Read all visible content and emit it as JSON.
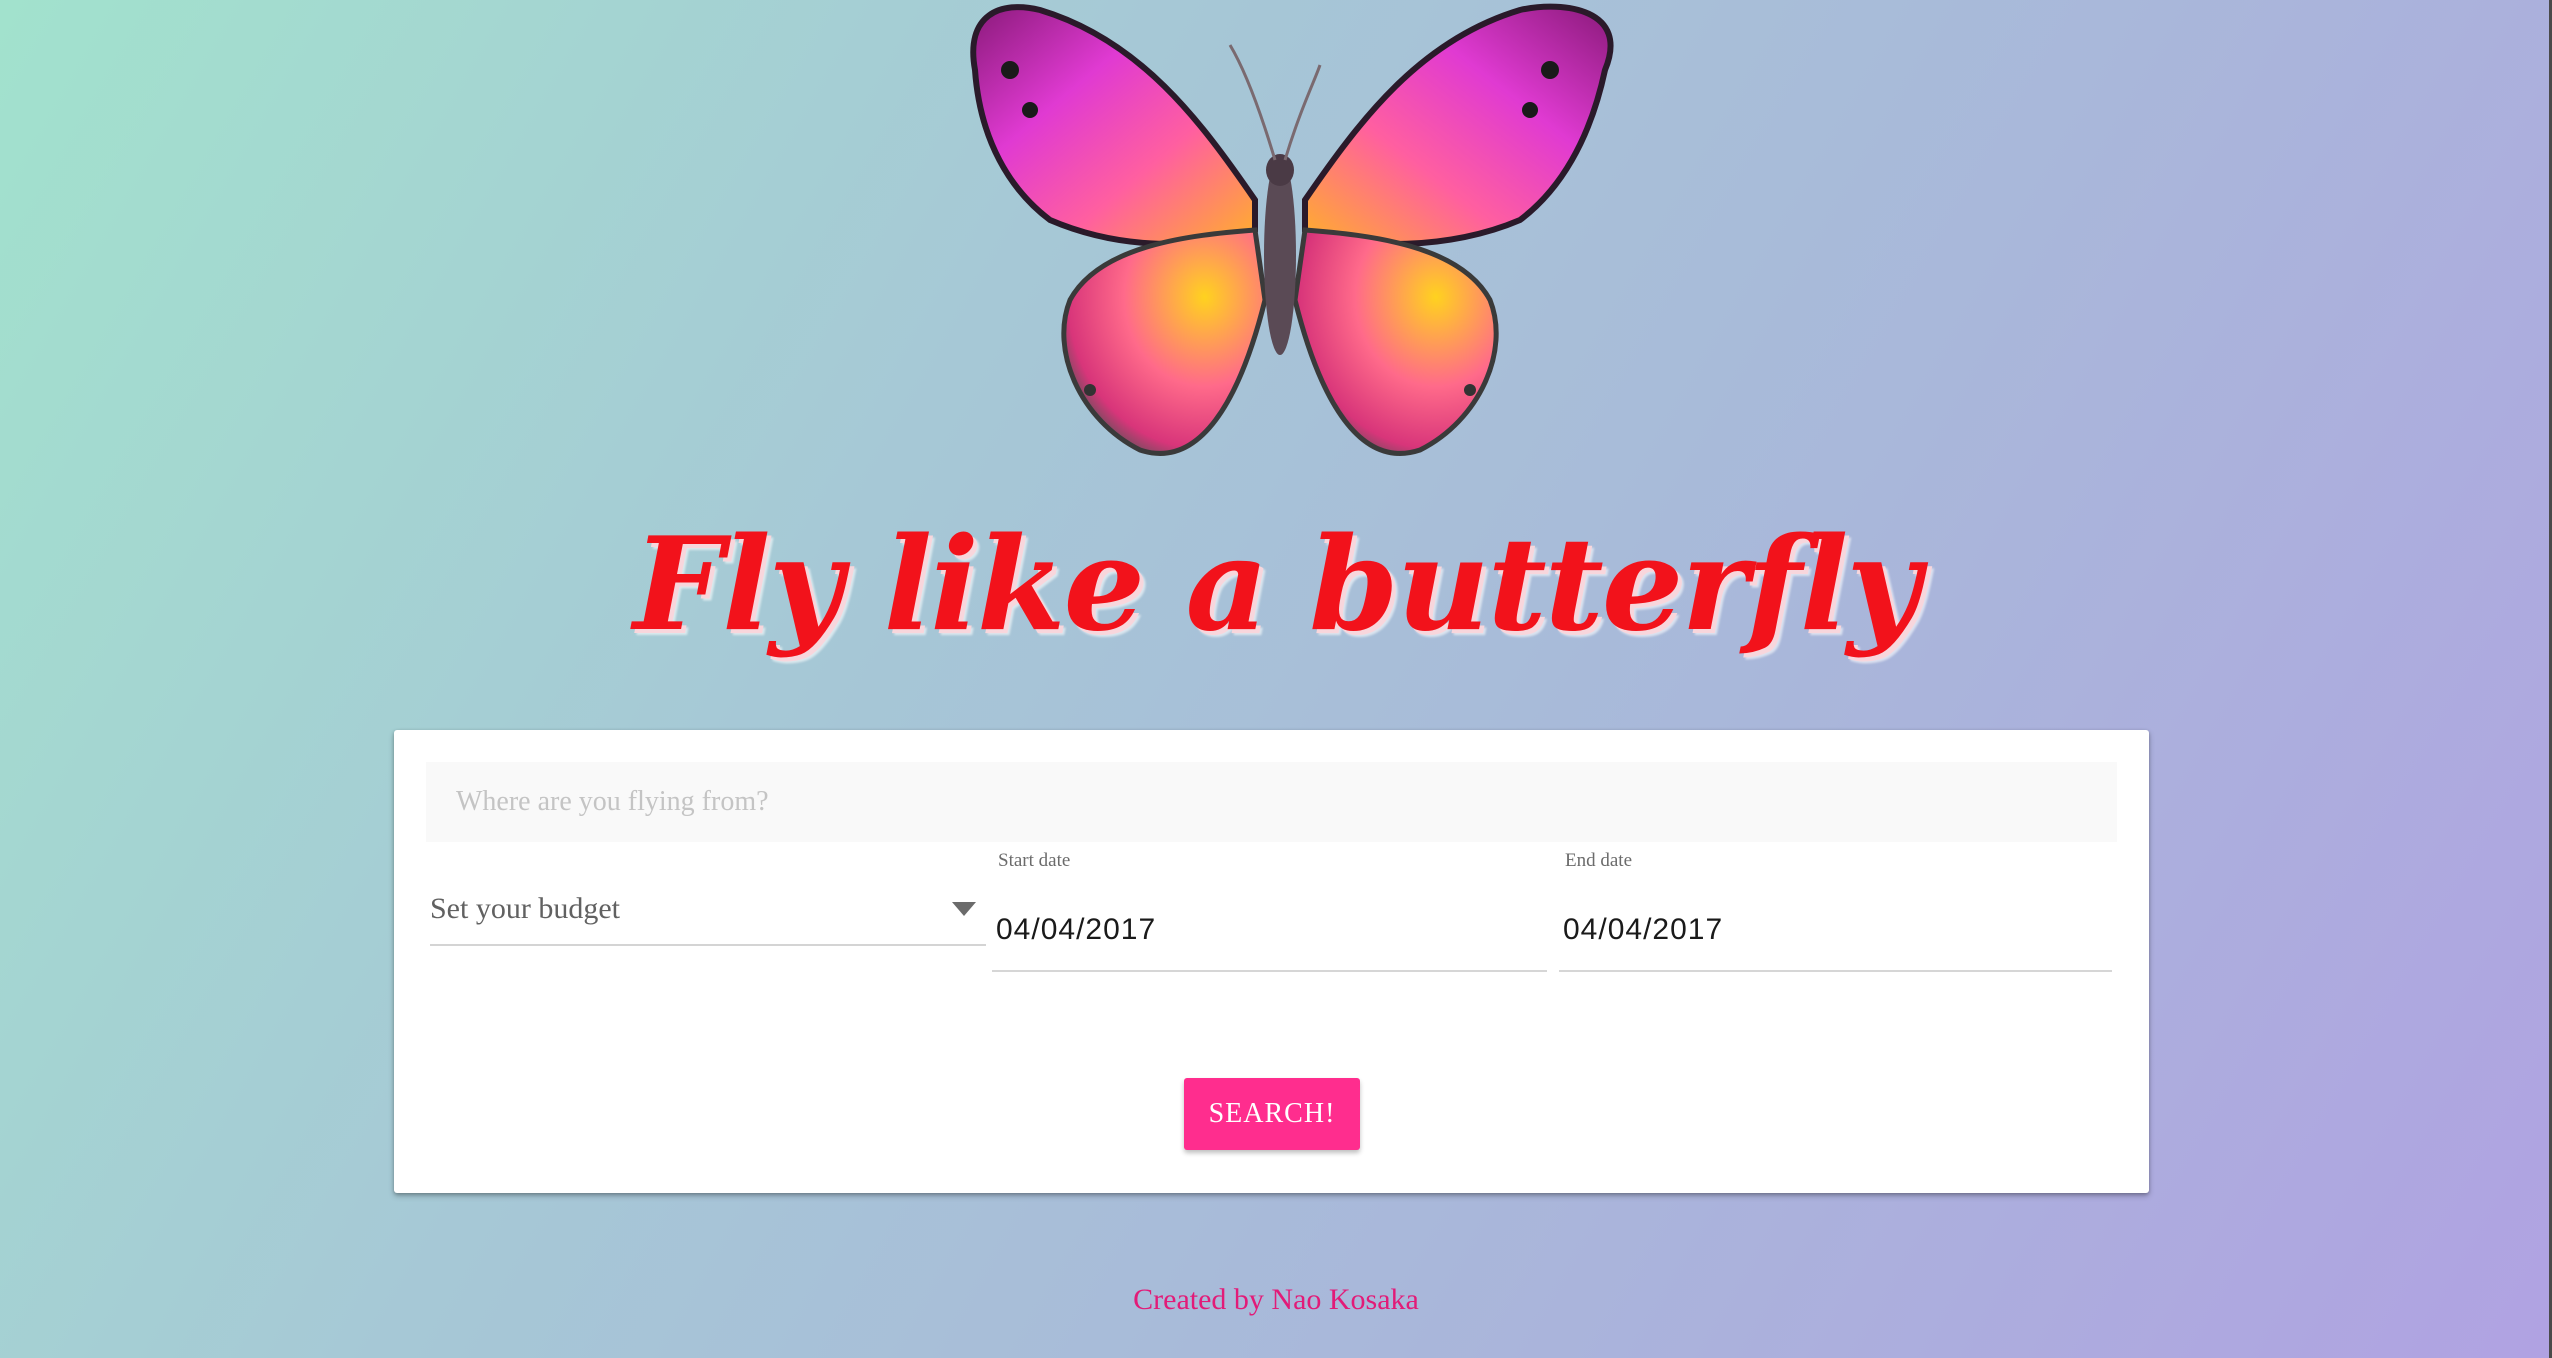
{
  "header": {
    "title": "Fly like a butterfly"
  },
  "form": {
    "origin_placeholder": "Where are you flying from?",
    "origin_value": "",
    "budget_label": "Set your budget",
    "start_date_label": "Start date",
    "start_date_value": "04/04/2017",
    "end_date_label": "End date",
    "end_date_value": "04/04/2017",
    "search_label": "SEARCH!"
  },
  "footer": {
    "credit": "Created by Nao Kosaka"
  },
  "colors": {
    "title": "#f2121b",
    "accent": "#ff2d8e",
    "footer": "#e21b78"
  },
  "icons": {
    "logo": "butterfly-icon",
    "dropdown": "triangle-down-icon"
  }
}
